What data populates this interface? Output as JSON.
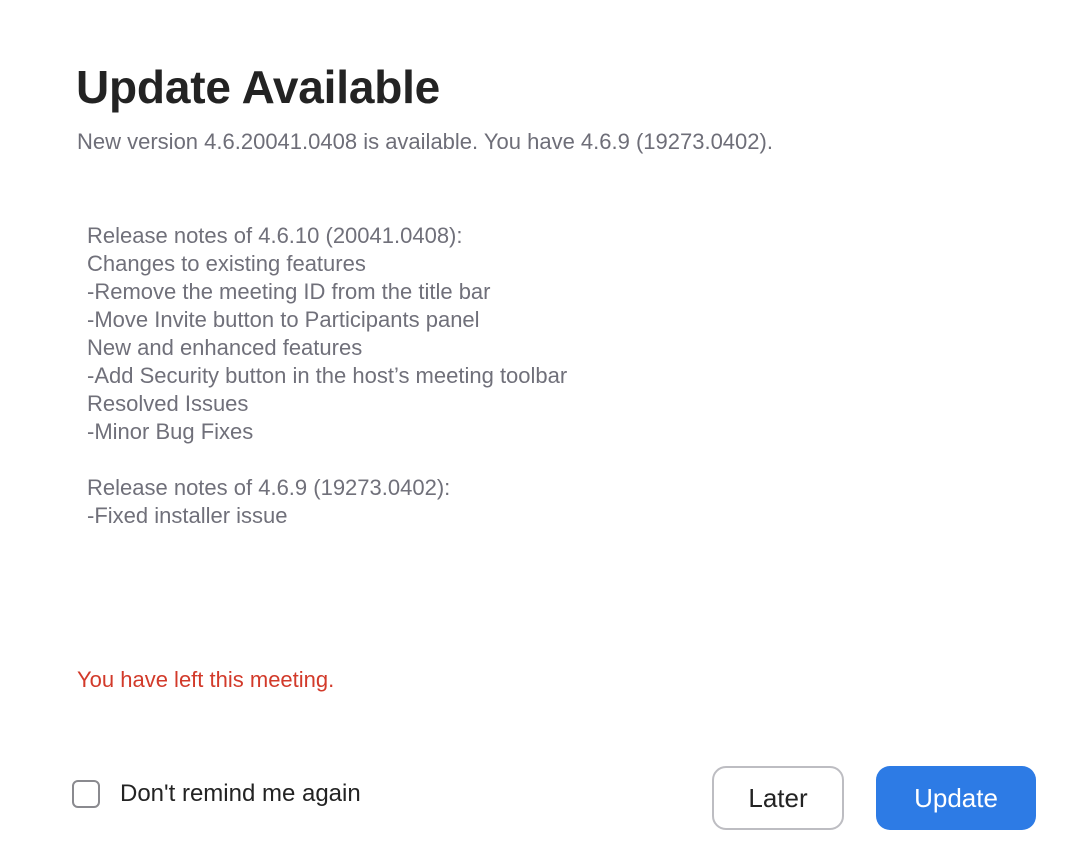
{
  "dialog": {
    "title": "Update Available",
    "subtitle": "New version 4.6.20041.0408 is available. You have 4.6.9 (19273.0402).",
    "release_notes": {
      "block1": [
        "Release notes of 4.6.10 (20041.0408):",
        "Changes to existing features",
        "-Remove the meeting ID from the title bar",
        "-Move Invite button to Participants panel",
        "New and enhanced features",
        "-Add Security button in the host’s meeting toolbar",
        "Resolved Issues",
        "-Minor Bug Fixes"
      ],
      "block2": [
        "Release notes of 4.6.9 (19273.0402):",
        "-Fixed installer issue"
      ]
    },
    "status_message": "You have left this meeting.",
    "remind_checkbox": {
      "label": "Don't remind me again",
      "checked": false
    },
    "buttons": {
      "later_label": "Later",
      "update_label": "Update"
    },
    "colors": {
      "accent": "#2d7be5",
      "error": "#d23a2a"
    }
  }
}
